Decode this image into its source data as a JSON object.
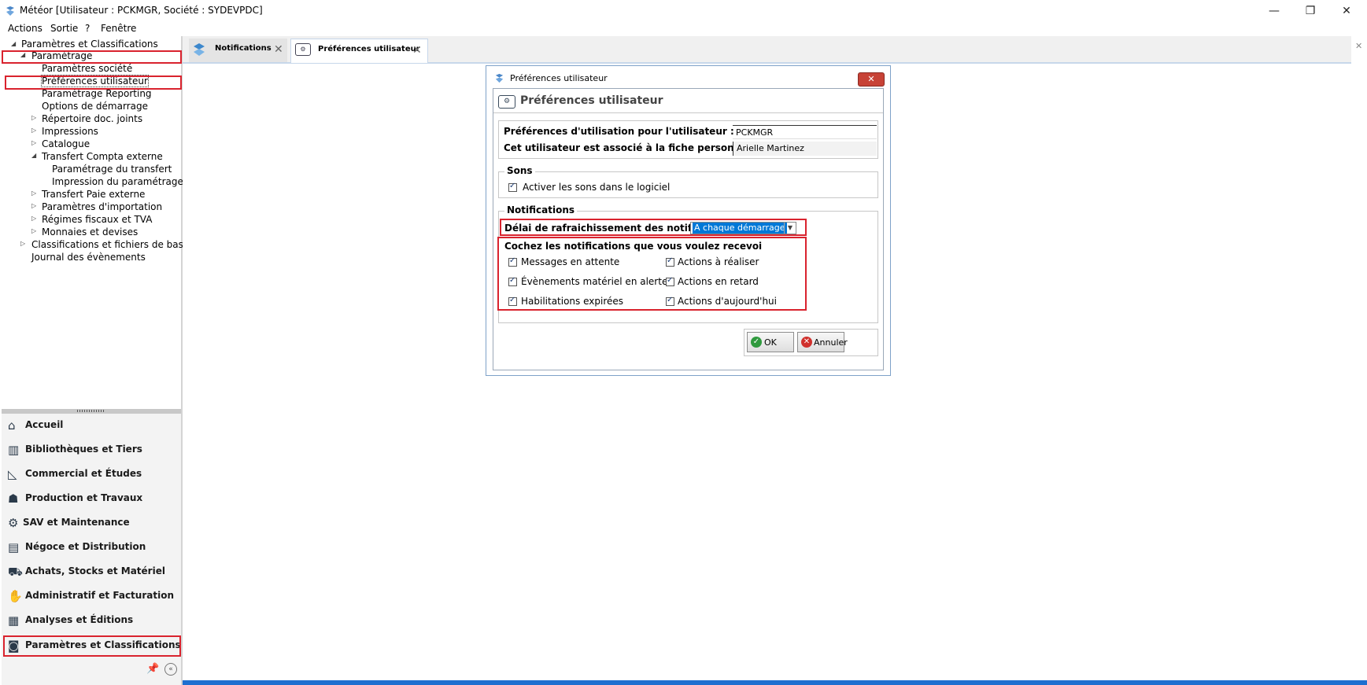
{
  "window": {
    "title": "Météor [Utilisateur : PCKMGR, Société : SYDEVPDC]"
  },
  "menu": [
    "Actions",
    "Sortie",
    "?",
    "Fenêtre"
  ],
  "tree": {
    "root": "Paramètres et Classifications",
    "parametrage": "Paramétrage",
    "items": [
      "Paramètres société",
      "Préférences utilisateur",
      "Paramétrage Reporting",
      "Options de démarrage",
      "Répertoire doc. joints",
      "Impressions",
      "Catalogue",
      "Transfert Compta externe",
      "Paramétrage du transfert",
      "Impression du paramétrage",
      "Transfert Paie externe",
      "Paramètres d'importation",
      "Régimes fiscaux et TVA",
      "Monnaies et devises"
    ],
    "classifications": "Classifications et fichiers de base",
    "journal": "Journal des évènements"
  },
  "nav": [
    "Accueil",
    "Bibliothèques et Tiers",
    "Commercial et Études",
    "Production et Travaux",
    "SAV et Maintenance",
    "Négoce et Distribution",
    "Achats, Stocks et Matériel",
    "Administratif et Facturation",
    "Analyses et Éditions",
    "Paramètres et Classifications"
  ],
  "tabs": [
    "Notifications",
    "Préférences utilisateur"
  ],
  "dialog": {
    "title": "Préférences utilisateur",
    "header": "Préférences utilisateur",
    "user_label": "Préférences d'utilisation pour l'utilisateur :",
    "user_value": "PCKMGR",
    "personnel_label": "Cet utilisateur est associé à la fiche personnel :",
    "personnel_value": "Arielle Martinez",
    "sons_title": "Sons",
    "sons_checkbox": "Activer les sons dans le logiciel",
    "notif_title": "Notifications",
    "delai_label": "Délai de rafraichissement des notifications",
    "delai_value": "A chaque démarrage",
    "cochez_label": "Cochez les notifications que vous voulez recevoi",
    "checks_left": [
      "Messages en attente",
      "Évènements matériel en alerte",
      "Habilitations expirées"
    ],
    "checks_right": [
      "Actions à réaliser",
      "Actions en retard",
      "Actions d'aujourd'hui"
    ],
    "ok": "OK",
    "cancel": "Annuler"
  },
  "colors": {
    "highlight_red": "#d9232e",
    "selection_blue": "#0078d7",
    "accent": "#1e6fd0"
  }
}
